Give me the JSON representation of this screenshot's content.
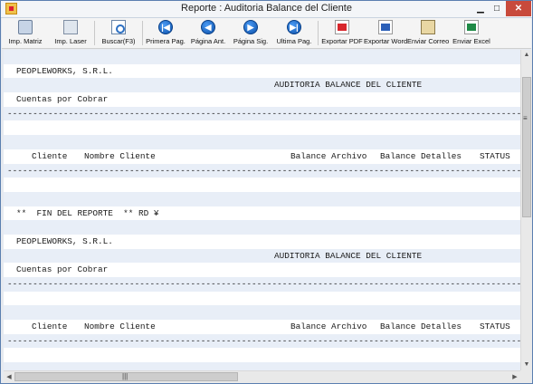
{
  "window": {
    "title": "Reporte : Auditoria Balance del Cliente",
    "minimize_glyph": "▁",
    "maximize_glyph": "□",
    "close_glyph": "✕"
  },
  "toolbar": {
    "items": [
      {
        "label": "Imp. Matriz",
        "icon": "printer-icon"
      },
      {
        "label": "Imp. Laser",
        "icon": "laser-printer-icon"
      },
      {
        "label": "Buscar(F3)",
        "icon": "search-icon"
      },
      {
        "label": "Primera Pag.",
        "icon": "first-page-icon",
        "glyph": "|◀"
      },
      {
        "label": "Página Ant.",
        "icon": "previous-page-icon",
        "glyph": "◀"
      },
      {
        "label": "Página Sig.",
        "icon": "next-page-icon",
        "glyph": "▶"
      },
      {
        "label": "Ultima Pag.",
        "icon": "last-page-icon",
        "glyph": "▶|"
      },
      {
        "label": "Exportar PDF",
        "icon": "pdf-icon"
      },
      {
        "label": "Exportar Word",
        "icon": "word-icon"
      },
      {
        "label": "Enviar Correo",
        "icon": "mail-icon"
      },
      {
        "label": "Enviar Excel",
        "icon": "excel-icon"
      }
    ]
  },
  "report": {
    "company": "PEOPLEWORKS, S.R.L.",
    "report_title": "AUDITORIA BALANCE DEL CLIENTE",
    "section": "Cuentas por Cobrar",
    "separator": "------------------------------------------------------------------------------------------------------------------------------------------------",
    "columns": {
      "cliente": "Cliente",
      "nombre": "Nombre Cliente",
      "balance_archivo": "Balance Archivo",
      "balance_detalles": "Balance Detalles",
      "status": "STATUS"
    },
    "end_marker": "**  FIN DEL REPORTE  ** RD ¥"
  },
  "scrollbars": {
    "up": "▲",
    "down": "▼",
    "left": "◀",
    "right": "▶",
    "grip_v": "≡",
    "grip_h": "|||"
  }
}
